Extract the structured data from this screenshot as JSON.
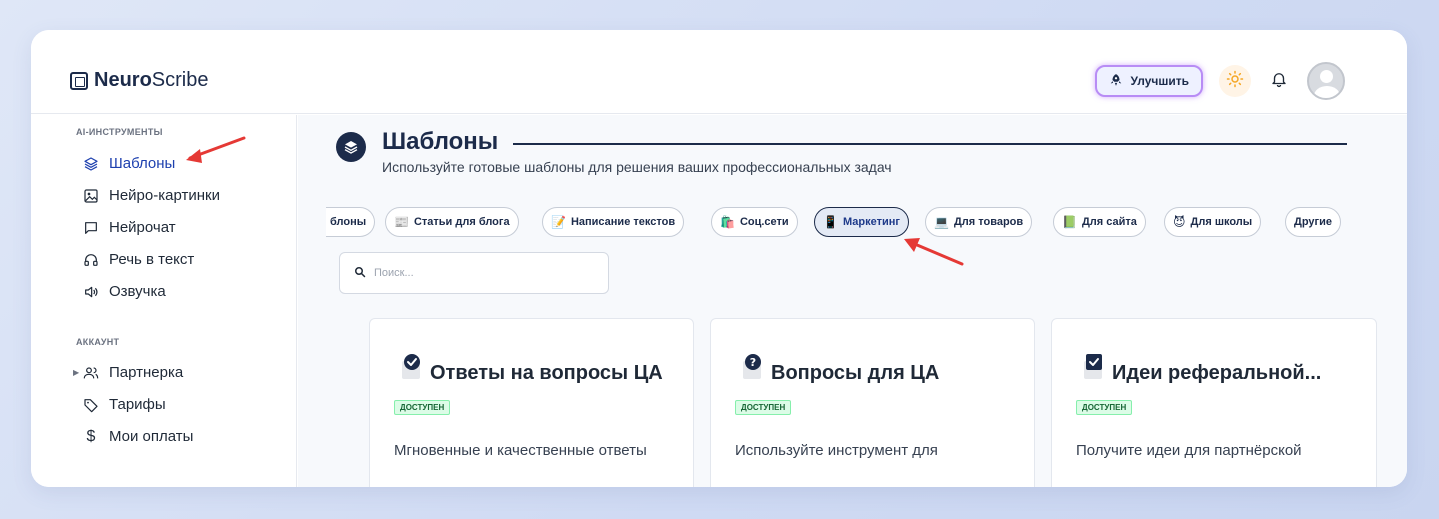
{
  "header": {
    "logo_bold": "Neuro",
    "logo_light": "Scribe",
    "upgrade_label": "Улучшить"
  },
  "sidebar": {
    "section_ai": "AI-ИНСТРУМЕНТЫ",
    "ai_items": [
      {
        "label": "Шаблоны",
        "icon": "layers-icon",
        "active": true
      },
      {
        "label": "Нейро-картинки",
        "icon": "image-icon"
      },
      {
        "label": "Нейрочат",
        "icon": "chat-icon"
      },
      {
        "label": "Речь в текст",
        "icon": "headphones-icon"
      },
      {
        "label": "Озвучка",
        "icon": "speaker-icon"
      }
    ],
    "section_account": "АККАУНТ",
    "account_items": [
      {
        "label": "Партнерка",
        "icon": "users-icon"
      },
      {
        "label": "Тарифы",
        "icon": "tag-icon"
      },
      {
        "label": "Мои оплаты",
        "icon": "dollar-icon"
      }
    ]
  },
  "main": {
    "title": "Шаблоны",
    "subtitle": "Используйте готовые шаблоны для решения ваших профессиональных задач",
    "chips": [
      {
        "label": "блоны",
        "emoji": ""
      },
      {
        "label": "Статьи для блога",
        "emoji": "📰"
      },
      {
        "label": "Написание текстов",
        "emoji": "📝"
      },
      {
        "label": "Соц.сети",
        "emoji": "🛍️"
      },
      {
        "label": "Маркетинг",
        "emoji": "📱",
        "active": true
      },
      {
        "label": "Для товаров",
        "emoji": "💻"
      },
      {
        "label": "Для сайта",
        "emoji": "📗"
      },
      {
        "label": "Для школы",
        "emoji": "😈"
      },
      {
        "label": "Другие",
        "emoji": ""
      }
    ],
    "search_placeholder": "Поиск...",
    "cards": [
      {
        "title": "Ответы на вопросы ЦА",
        "badge": "ДОСТУПЕН",
        "description": "Мгновенные и качественные ответы",
        "icon": "check-doc-icon"
      },
      {
        "title": "Вопросы для ЦА",
        "badge": "ДОСТУПЕН",
        "description": "Используйте инструмент для",
        "icon": "question-doc-icon"
      },
      {
        "title": "Идеи реферальной...",
        "badge": "ДОСТУПЕН",
        "description": "Получите идеи для партнёрской",
        "icon": "checkbox-doc-icon"
      }
    ]
  },
  "colors": {
    "brand_dark": "#1c2b4a",
    "accent_blue": "#1e40af",
    "badge_green": "#166534",
    "arrow_red": "#e53935"
  }
}
